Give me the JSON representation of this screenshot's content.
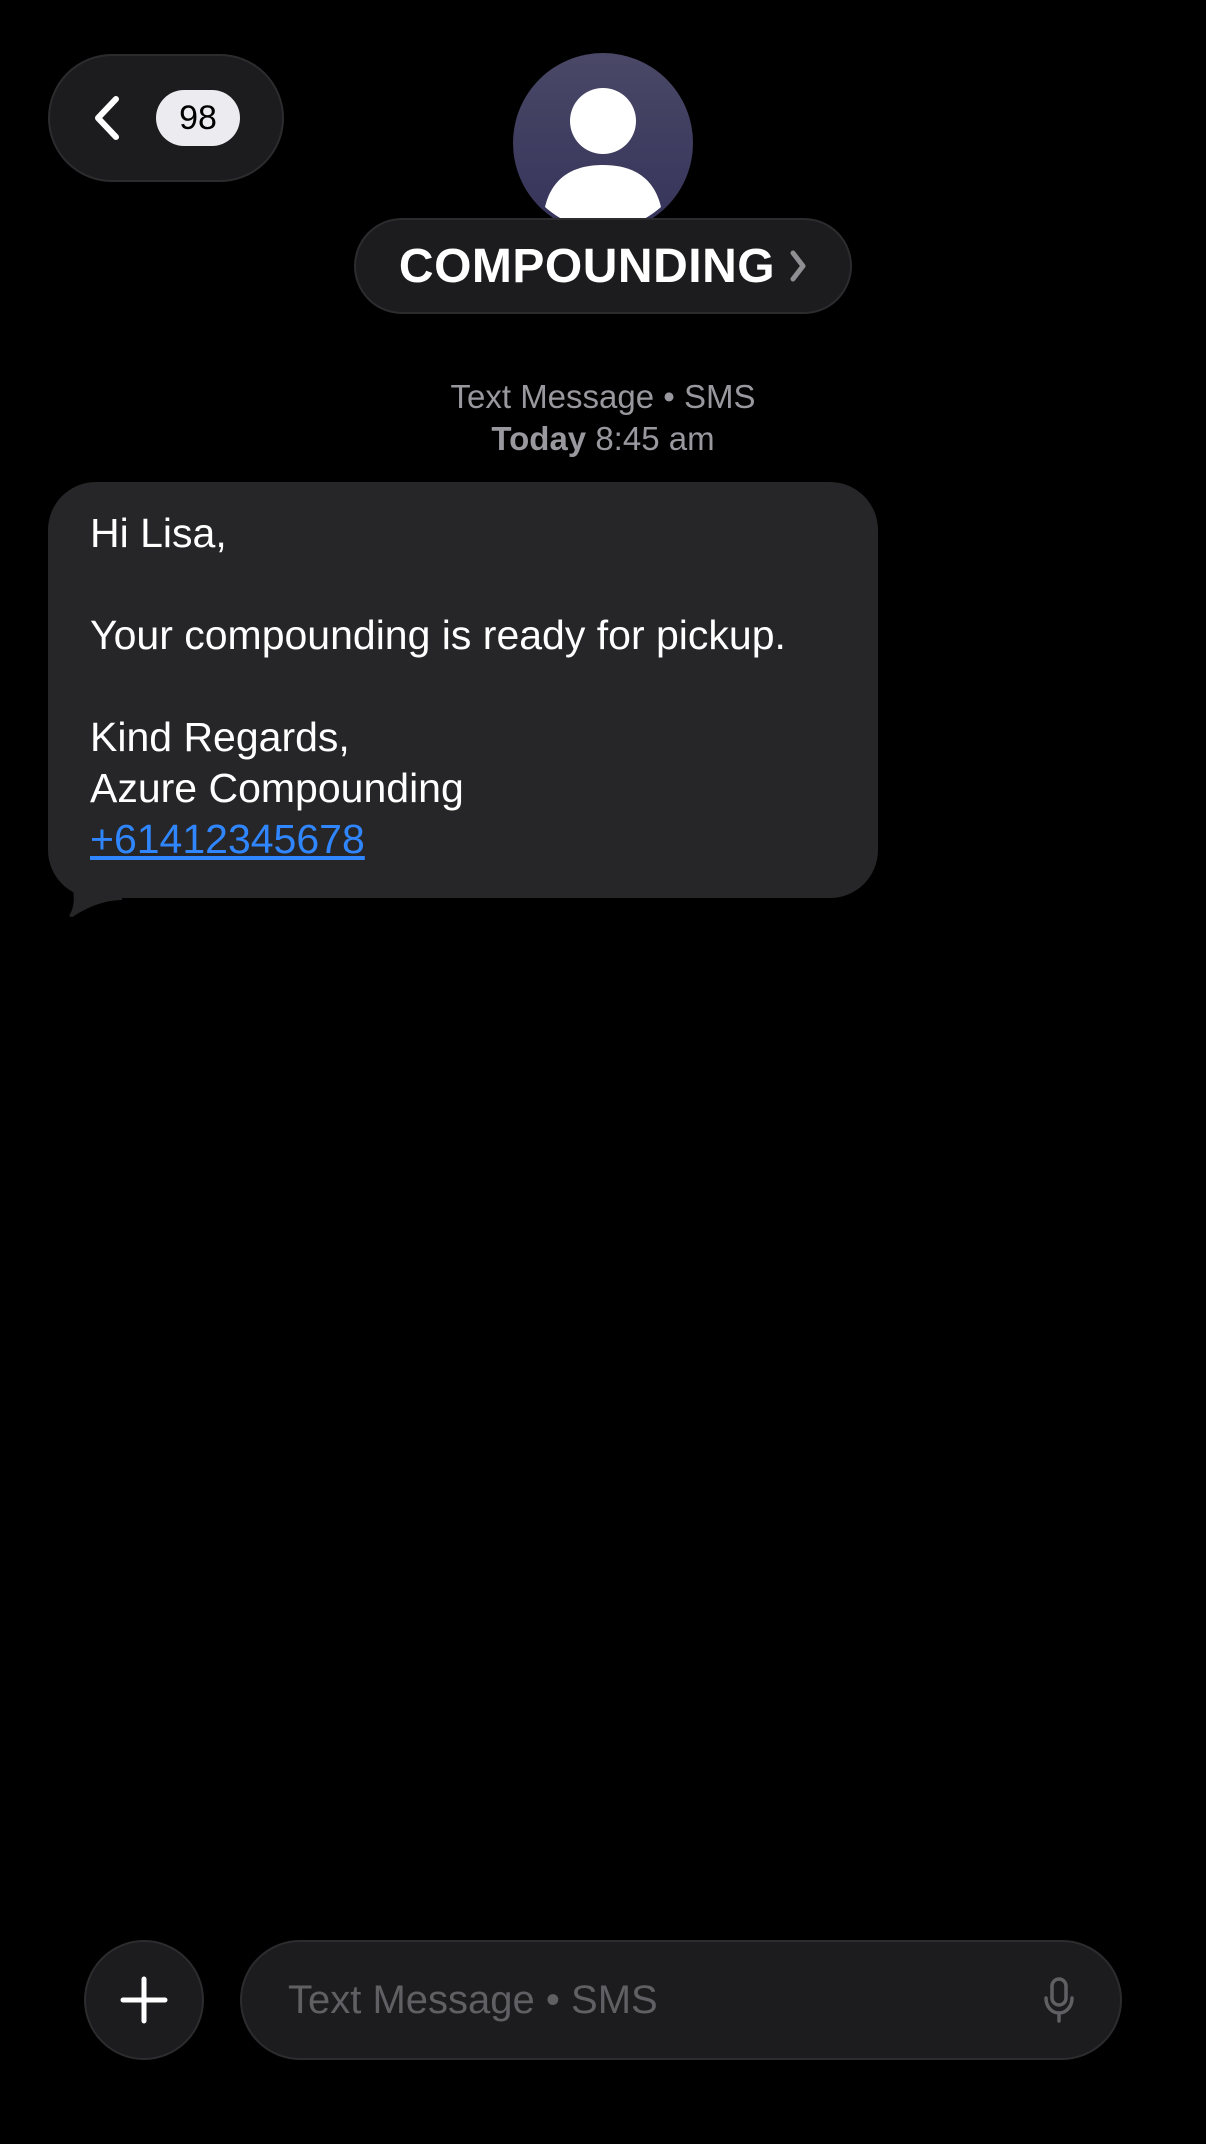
{
  "header": {
    "unread_count": "98",
    "contact_name": "COMPOUNDING"
  },
  "meta": {
    "service": "Text Message • SMS",
    "day": "Today",
    "time": "8:45 am"
  },
  "message": {
    "greeting": "Hi Lisa,",
    "body": "Your compounding is ready for pickup.",
    "signoff": "Kind Regards,",
    "sender": "Azure Compounding",
    "phone": "+61412345678"
  },
  "composer": {
    "placeholder": "Text Message • SMS"
  },
  "colors": {
    "background": "#000000",
    "bubble": "#262628",
    "link": "#2f86ff",
    "secondary_text": "#98989e"
  },
  "icons": [
    "back-chevron-icon",
    "person-icon",
    "chevron-right-icon",
    "plus-icon",
    "microphone-icon"
  ]
}
